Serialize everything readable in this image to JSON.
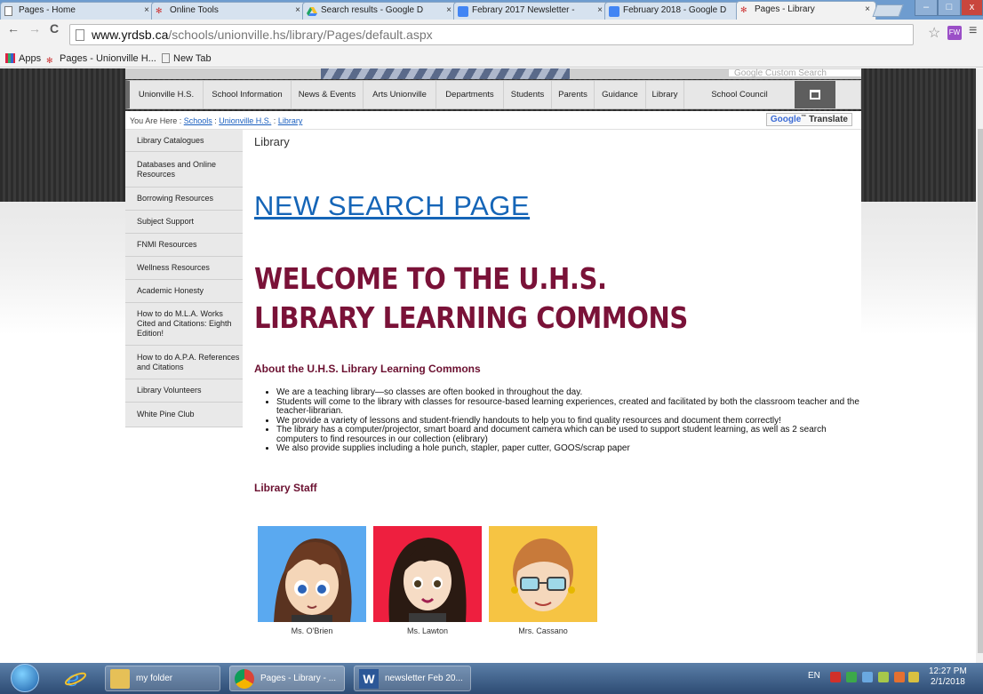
{
  "browser": {
    "tabs": [
      {
        "title": "Pages - Home",
        "close": "×"
      },
      {
        "title": "Online Tools",
        "close": "×"
      },
      {
        "title": "Search results - Google D",
        "close": "×"
      },
      {
        "title": "Febrary 2017 Newsletter -",
        "close": "×"
      },
      {
        "title": "February 2018 - Google D",
        "close": "×"
      },
      {
        "title": "Pages - Library",
        "close": "×"
      }
    ],
    "window_controls": {
      "minimize": "–",
      "maximize": "□",
      "close": "x"
    },
    "nav": {
      "back": "←",
      "forward": "→",
      "reload": "C"
    },
    "url_host": "www.yrdsb.ca",
    "url_path": "/schools/unionville.hs/library/Pages/default.aspx",
    "star": "☆",
    "extension_label": "FW",
    "menu": "≡",
    "bookmarks": [
      {
        "label": "Apps"
      },
      {
        "label": "Pages - Unionville H..."
      },
      {
        "label": "New Tab"
      }
    ]
  },
  "site": {
    "custom_search_placeholder": "Google Custom Search",
    "nav_items": [
      "Unionville H.S.",
      "School Information",
      "News & Events",
      "Arts Unionville",
      "Departments",
      "Students",
      "Parents",
      "Guidance",
      "Library",
      "School Council"
    ],
    "breadcrumb": {
      "prefix": "You Are Here : ",
      "links": [
        "Schools",
        "Unionville H.S.",
        "Library"
      ],
      "sep": " : "
    },
    "translate": {
      "google": "Google",
      "tm": "™",
      "label": " Translate"
    },
    "sidebar": [
      "Library Catalogues",
      "Databases and Online Resources",
      "Borrowing Resources",
      "Subject Support",
      "FNMI Resources",
      "Wellness Resources",
      "Academic Honesty",
      "How to do M.L.A. Works Cited and Citations: Eighth Edition!",
      "How to do A.P.A. References and Citations",
      "Library Volunteers",
      "White Pine Club"
    ],
    "page_title": "Library",
    "new_search": "NEW SEARCH PAGE",
    "welcome": "WELCOME TO THE U.H.S. LIBRARY LEARNING COMMONS",
    "about_heading": "About the U.H.S. Library Learning Commons",
    "bullets": [
      "We are a teaching library—so classes are often booked in throughout the day.",
      "Students will come to the library with classes for resource-based learning experiences, created and facilitated by both the classroom teacher and the teacher-librarian.",
      "We provide a variety of lessons and student-friendly handouts to help you to find quality resources and document them correctly!",
      "The library has a computer/projector, smart board and document camera which can be used to support  student learning, as well as 2 search computers to find resources in our collection (elibrary)",
      "We also provide supplies including a hole punch, stapler, paper cutter, GOOS/scrap paper"
    ],
    "staff_heading": "Library Staff",
    "staff": [
      {
        "name": "Ms. O'Brien",
        "bg": "#5aa9f0"
      },
      {
        "name": "Ms. Lawton",
        "bg": "#ee1f3f"
      },
      {
        "name": "Mrs. Cassano",
        "bg": "#f6c443"
      }
    ],
    "colors": {
      "heading": "#7a1238",
      "link": "#1565b7"
    }
  },
  "taskbar": {
    "buttons": [
      {
        "label": "my folder"
      },
      {
        "label": "Pages - Library - ..."
      },
      {
        "label": "newsletter Feb 20..."
      }
    ],
    "lang": "EN",
    "time": "12:27 PM",
    "date": "2/1/2018"
  }
}
